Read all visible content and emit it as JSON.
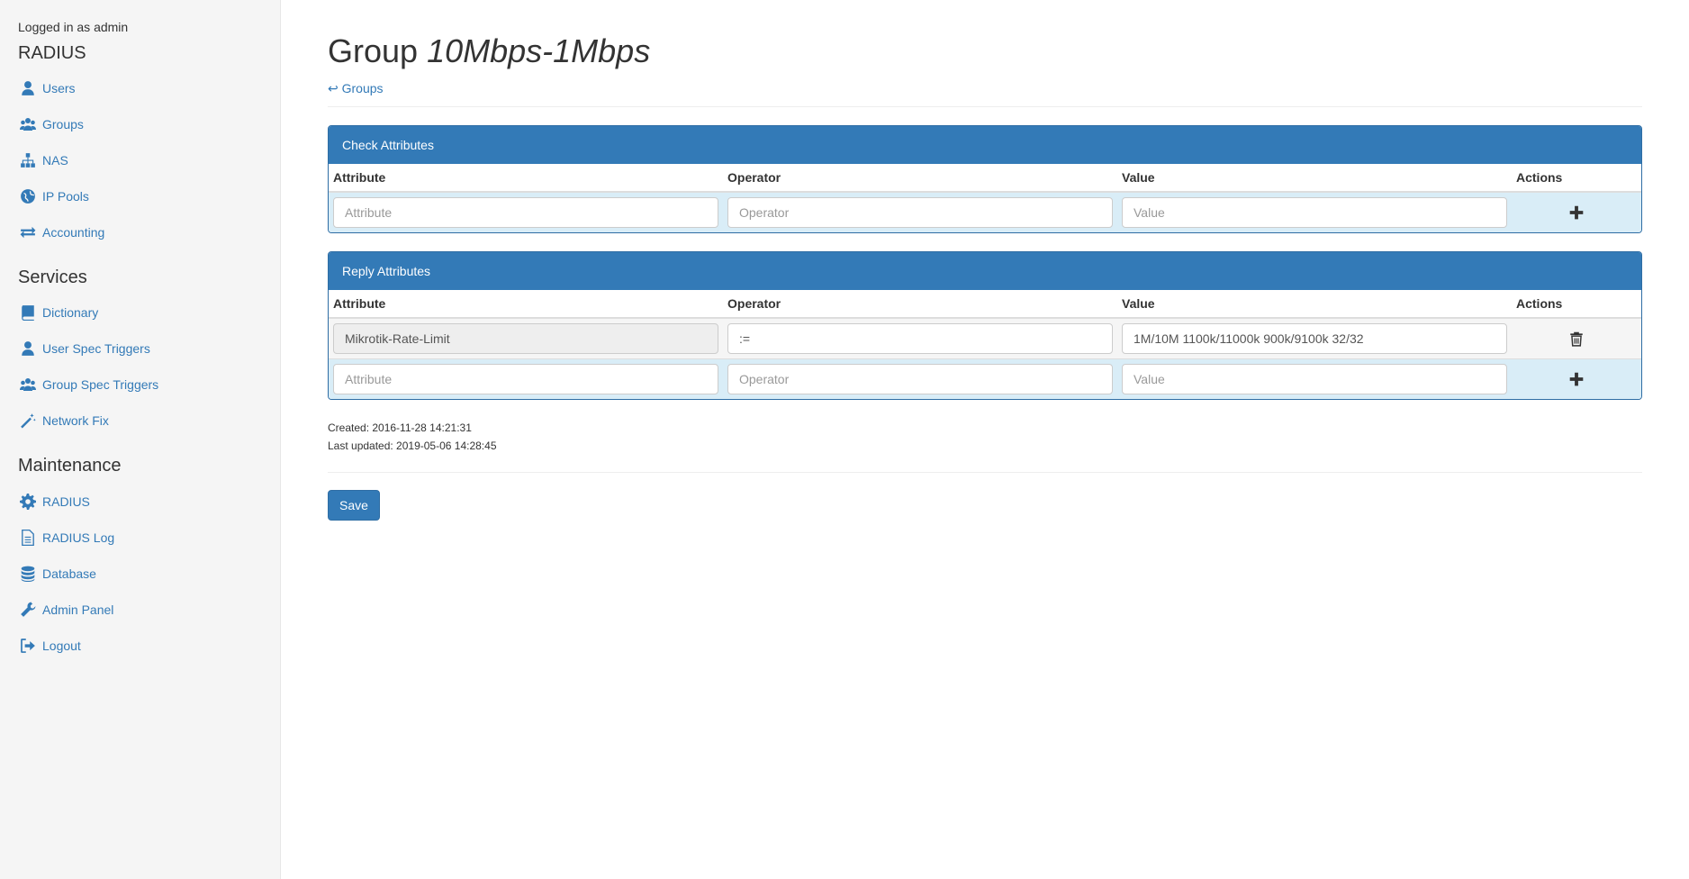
{
  "sidebar": {
    "logged_in": "Logged in as admin",
    "sections": [
      {
        "title": "RADIUS",
        "items": [
          {
            "label": "Users",
            "icon": "user-icon"
          },
          {
            "label": "Groups",
            "icon": "users-icon"
          },
          {
            "label": "NAS",
            "icon": "sitemap-icon"
          },
          {
            "label": "IP Pools",
            "icon": "globe-icon"
          },
          {
            "label": "Accounting",
            "icon": "exchange-icon"
          }
        ]
      },
      {
        "title": "Services",
        "items": [
          {
            "label": "Dictionary",
            "icon": "book-icon"
          },
          {
            "label": "User Spec Triggers",
            "icon": "user-icon"
          },
          {
            "label": "Group Spec Triggers",
            "icon": "users-icon"
          },
          {
            "label": "Network Fix",
            "icon": "magic-wand-icon"
          }
        ]
      },
      {
        "title": "Maintenance",
        "items": [
          {
            "label": "RADIUS",
            "icon": "gear-icon"
          },
          {
            "label": "RADIUS Log",
            "icon": "file-text-icon"
          },
          {
            "label": "Database",
            "icon": "database-icon"
          },
          {
            "label": "Admin Panel",
            "icon": "wrench-icon"
          },
          {
            "label": "Logout",
            "icon": "sign-out-icon"
          }
        ]
      }
    ]
  },
  "page": {
    "title_prefix": "Group",
    "group_name": "10Mbps-1Mbps",
    "back_link": "↩ Groups"
  },
  "check_attributes": {
    "title": "Check Attributes",
    "columns": [
      "Attribute",
      "Operator",
      "Value",
      "Actions"
    ],
    "new_row": {
      "attribute_placeholder": "Attribute",
      "operator_placeholder": "Operator",
      "value_placeholder": "Value"
    }
  },
  "reply_attributes": {
    "title": "Reply Attributes",
    "columns": [
      "Attribute",
      "Operator",
      "Value",
      "Actions"
    ],
    "rows": [
      {
        "attribute": "Mikrotik-Rate-Limit",
        "operator": ":=",
        "value": "1M/10M 1100k/11000k 900k/9100k 32/32"
      }
    ],
    "new_row": {
      "attribute_placeholder": "Attribute",
      "operator_placeholder": "Operator",
      "value_placeholder": "Value"
    }
  },
  "meta": {
    "created": "Created: 2016-11-28 14:21:31",
    "updated": "Last updated: 2019-05-06 14:28:45"
  },
  "save_label": "Save",
  "colors": {
    "primary": "#337ab7",
    "new_row_bg": "#d9edf7"
  }
}
